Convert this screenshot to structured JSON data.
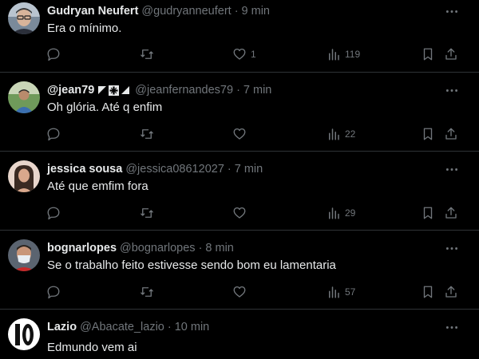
{
  "tweets": [
    {
      "name": "Gudryan Neufert",
      "handle": "@gudryanneufert",
      "separator": "·",
      "time": "9 min",
      "text": "Era o mínimo.",
      "replies": "",
      "retweets": "",
      "likes": "1",
      "views": "119",
      "avatar_icon": "person-glasses-avatar"
    },
    {
      "name": "@jean79",
      "handle": "@jeanfernandes79",
      "separator": "·",
      "time": "7 min",
      "text": "Oh glória.  Até q enfim",
      "replies": "",
      "retweets": "",
      "likes": "",
      "views": "22",
      "avatar_icon": "person-outdoor-avatar",
      "name_emoji_icons": [
        "flag-corner-icon",
        "cross-emblem-icon",
        "flag-corner-icon"
      ]
    },
    {
      "name": "jessica sousa",
      "handle": "@jessica08612027",
      "separator": "·",
      "time": "7 min",
      "text": "Até que emfim fora",
      "replies": "",
      "retweets": "",
      "likes": "",
      "views": "29",
      "avatar_icon": "woman-avatar"
    },
    {
      "name": "bognarlopes",
      "handle": "@bognarlopes",
      "separator": "·",
      "time": "8 min",
      "text": "Se o trabalho feito estivesse sendo bom eu lamentaria",
      "replies": "",
      "retweets": "",
      "likes": "",
      "views": "57",
      "avatar_icon": "man-mask-avatar"
    },
    {
      "name": "Lazio",
      "handle": "@Abacate_lazio",
      "separator": "·",
      "time": "10 min",
      "text": "Edmundo vem ai",
      "avatar_icon": "number-ten-avatar"
    }
  ],
  "colors": {
    "background": "#000000",
    "text": "#e7e9ea",
    "muted": "#71767b",
    "divider": "#2f3336"
  }
}
